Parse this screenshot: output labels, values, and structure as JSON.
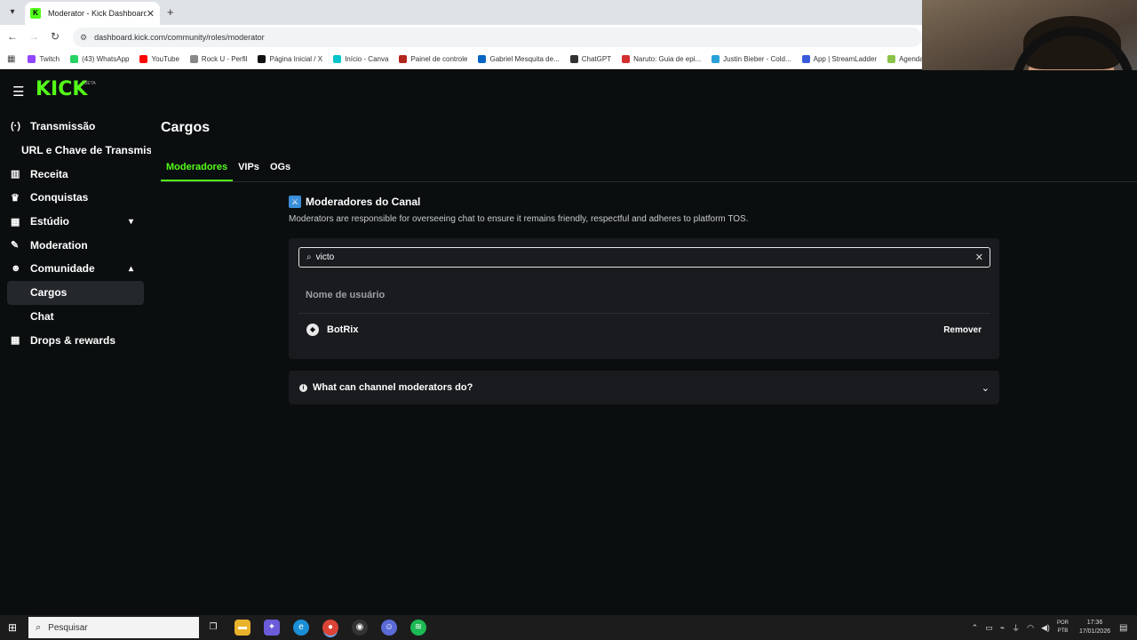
{
  "browser": {
    "tab_title": "Moderator - Kick Dashboard",
    "url": "dashboard.kick.com/community/roles/moderator",
    "bookmarks": [
      {
        "label": "Twitch",
        "color": "#9146ff"
      },
      {
        "label": "(43) WhatsApp",
        "color": "#25d366"
      },
      {
        "label": "YouTube",
        "color": "#ff0000"
      },
      {
        "label": "Rock U - Perfil",
        "color": "#888888"
      },
      {
        "label": "Página Inicial / X",
        "color": "#111111"
      },
      {
        "label": "Início - Canva",
        "color": "#00c4cc"
      },
      {
        "label": "Painel de controle",
        "color": "#b3261e"
      },
      {
        "label": "Gabriel Mesquita de...",
        "color": "#0a66c2"
      },
      {
        "label": "ChatGPT",
        "color": "#333333"
      },
      {
        "label": "Naruto: Guia de epi...",
        "color": "#d32f2f"
      },
      {
        "label": "Justin Bieber - Cold...",
        "color": "#2aa1d8"
      },
      {
        "label": "App | StreamLadder",
        "color": "#3b5bdb"
      },
      {
        "label": "Agenda",
        "color": "#8bc34a"
      }
    ]
  },
  "app": {
    "brand": "KICK",
    "brand_badge": "BETA",
    "sidebar": [
      {
        "label": "Transmissão",
        "icon": "broadcast-icon",
        "glyph": "((·))",
        "name": "sidebar-item-transmissao"
      },
      {
        "label": "URL e Chave de Transmissão",
        "icon": "",
        "glyph": "",
        "name": "sidebar-item-url-chave"
      },
      {
        "label": "Receita",
        "icon": "chart-icon",
        "glyph": "▥",
        "name": "sidebar-item-receita"
      },
      {
        "label": "Conquistas",
        "icon": "trophy-icon",
        "glyph": "🏆",
        "name": "sidebar-item-conquistas"
      },
      {
        "label": "Estúdio",
        "icon": "studio-icon",
        "glyph": "▦",
        "name": "sidebar-item-estudio"
      },
      {
        "label": "Moderation",
        "icon": "wrench-icon",
        "glyph": "🔧",
        "name": "sidebar-item-moderation"
      },
      {
        "label": "Comunidade",
        "icon": "community-icon",
        "glyph": "👥",
        "name": "sidebar-item-comunidade"
      },
      {
        "label": "Cargos",
        "icon": "",
        "glyph": "",
        "name": "sidebar-item-cargos"
      },
      {
        "label": "Chat",
        "icon": "",
        "glyph": "",
        "name": "sidebar-item-chat"
      },
      {
        "label": "Drops & rewards",
        "icon": "gift-icon",
        "glyph": "▦",
        "name": "sidebar-item-drops"
      }
    ],
    "page_title": "Cargos",
    "tabs": [
      "Moderadores",
      "VIPs",
      "OGs"
    ],
    "section_title": "Moderadores do Canal",
    "section_desc": "Moderators are responsible for overseeing chat to ensure it remains friendly, respectful and adheres to platform TOS.",
    "search_value": "victo",
    "column_header": "Nome de usuário",
    "moderators": [
      {
        "username": "BotRix",
        "action": "Remover"
      }
    ],
    "faq_title": "What can channel moderators do?",
    "accent": "#53fc18"
  },
  "taskbar": {
    "search_placeholder": "Pesquisar",
    "lang_line1": "POR",
    "lang_line2": "PTB",
    "time": "17:36",
    "date": "17/01/2026"
  }
}
